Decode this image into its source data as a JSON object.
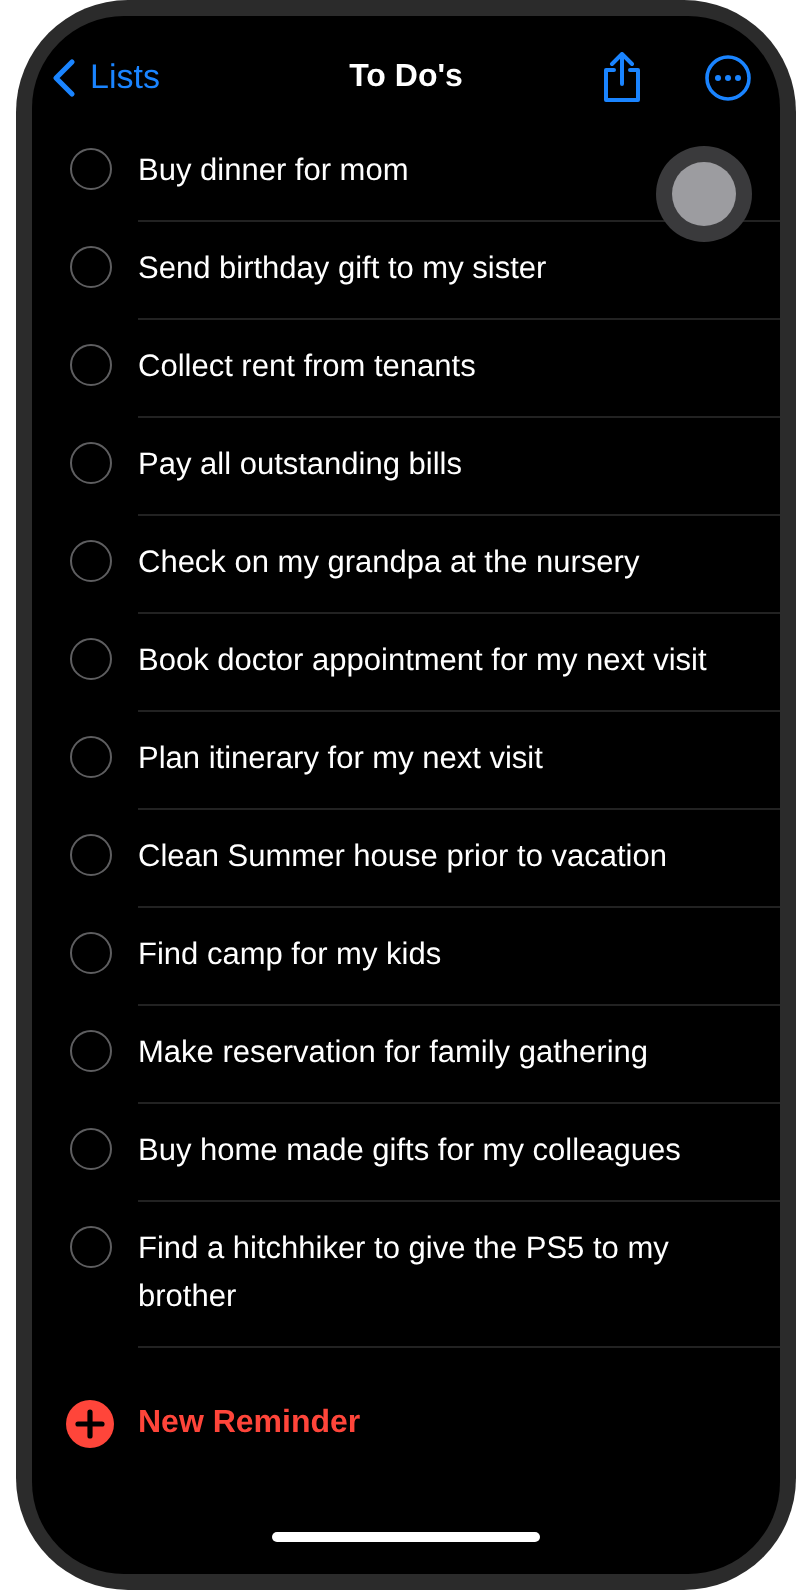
{
  "nav": {
    "back": "Lists",
    "title": "To Do's"
  },
  "reminders": [
    {
      "text": "Buy dinner for mom",
      "checked": false
    },
    {
      "text": "Send birthday gift to my sister",
      "checked": false
    },
    {
      "text": "Collect rent from tenants",
      "checked": false
    },
    {
      "text": "Pay all outstanding bills",
      "checked": false
    },
    {
      "text": "Check on my grandpa at the nursery",
      "checked": false
    },
    {
      "text": "Book doctor appointment for my next visit",
      "checked": false
    },
    {
      "text": "Plan itinerary for my next visit",
      "checked": false
    },
    {
      "text": "Clean Summer house prior to vacation",
      "checked": false
    },
    {
      "text": "Find camp for my kids",
      "checked": false
    },
    {
      "text": "Make reservation for family gathering",
      "checked": false
    },
    {
      "text": "Buy home made gifts for my colleagues",
      "checked": false
    },
    {
      "text": "Find a hitchhiker to give the PS5 to my brother",
      "checked": false
    }
  ],
  "new_reminder": "New Reminder"
}
